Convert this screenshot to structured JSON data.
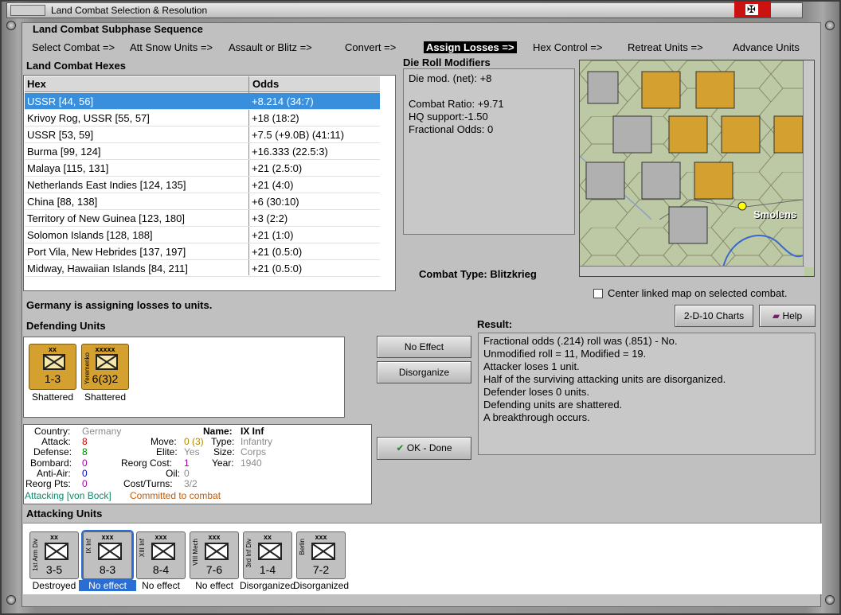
{
  "window": {
    "title": "Land Combat Selection & Resolution"
  },
  "sequence": {
    "title": "Land Combat Subphase Sequence",
    "steps": [
      "Select Combat =>",
      "Att Snow Units =>",
      "Assault or Blitz =>",
      "Convert =>",
      "Assign Losses =>",
      "Hex Control =>",
      "Retreat Units =>",
      "Advance Units"
    ],
    "active_index": 4
  },
  "hexes": {
    "title": "Land Combat Hexes",
    "col_hex": "Hex",
    "col_odds": "Odds",
    "rows": [
      {
        "hex": "USSR [44, 56]",
        "odds": "+8.214 (34:7)"
      },
      {
        "hex": "Krivoy Rog, USSR [55, 57]",
        "odds": "+18 (18:2)"
      },
      {
        "hex": "USSR [53, 59]",
        "odds": "+7.5 (+9.0B) (41:11)"
      },
      {
        "hex": "Burma [99, 124]",
        "odds": "+16.333 (22.5:3)"
      },
      {
        "hex": "Malaya [115, 131]",
        "odds": "+21 (2.5:0)"
      },
      {
        "hex": "Netherlands East Indies [124, 135]",
        "odds": "+21 (4:0)"
      },
      {
        "hex": "China [88, 138]",
        "odds": "+6 (30:10)"
      },
      {
        "hex": "Territory of New Guinea [123, 180]",
        "odds": "+3 (2:2)"
      },
      {
        "hex": "Solomon Islands [128, 188]",
        "odds": "+21 (1:0)"
      },
      {
        "hex": "Port Vila, New Hebrides [137, 197]",
        "odds": "+21 (0.5:0)"
      },
      {
        "hex": "Midway, Hawaiian Islands [84, 211]",
        "odds": "+21 (0.5:0)"
      }
    ]
  },
  "modifiers": {
    "title": "Die Roll Modifiers",
    "lines": [
      "Die mod. (net): +8",
      "",
      "Combat Ratio: +9.71",
      "HQ support:-1.50",
      "Fractional Odds: 0"
    ]
  },
  "map": {
    "city_label": "Smolens"
  },
  "combat_type": "Combat Type:  Blitzkrieg",
  "center_map_label": "Center linked map on selected combat.",
  "buttons": {
    "charts": "2-D-10 Charts",
    "help": "Help",
    "no_effect": "No Effect",
    "disorganize": "Disorganize",
    "ok_done": "OK - Done"
  },
  "status_message": "Germany is assigning losses to units.",
  "defending": {
    "title": "Defending Units",
    "units": [
      {
        "size": "xx",
        "strength": "1-3",
        "status": "Shattered",
        "side_label": ""
      },
      {
        "size": "xxxxx",
        "strength": "6(3)2",
        "status": "Shattered",
        "side_label": "Yeremenko"
      }
    ]
  },
  "unit_info": {
    "country_label": "Country:",
    "country": "Germany",
    "attack_label": "Attack:",
    "attack": "8",
    "defense_label": "Defense:",
    "defense": "8",
    "bombard_label": "Bombard:",
    "bombard": "0",
    "antiair_label": "Anti-Air:",
    "antiair": "0",
    "reorg_pts_label": "Reorg Pts:",
    "reorg_pts": "0",
    "move_label": "Move:",
    "move": "0 (3)",
    "elite_label": "Elite:",
    "elite": "Yes",
    "reorg_cost_label": "Reorg Cost:",
    "reorg_cost": "1",
    "oil_label": "Oil:",
    "oil": "0",
    "cost_turns_label": "Cost/Turns:",
    "cost_turns": "3/2",
    "name_label": "Name:",
    "name": "IX Inf",
    "type_label": "Type:",
    "type": "Infantry",
    "size_label": "Size:",
    "size": "Corps",
    "year_label": "Year:",
    "year": "1940",
    "attacking": "Attacking [von Bock]",
    "committed": "Committed to combat"
  },
  "result": {
    "title": "Result:",
    "lines": [
      "Fractional odds (.214) roll was (.851)  - No.",
      "Unmodified roll = 11, Modified = 19.",
      "Attacker loses 1 unit.",
      "Half of the surviving attacking units are disorganized.",
      "Defender loses 0 units.",
      "Defending units are shattered.",
      "A breakthrough occurs."
    ]
  },
  "attacking": {
    "title": "Attacking Units",
    "selected_index": 1,
    "units": [
      {
        "size": "xx",
        "strength": "3-5",
        "status": "Destroyed",
        "side_label": "1st Arm Div"
      },
      {
        "size": "xxx",
        "strength": "8-3",
        "status": "No effect",
        "side_label": "IX Inf"
      },
      {
        "size": "xxx",
        "strength": "8-4",
        "status": "No effect",
        "side_label": "XIII Inf"
      },
      {
        "size": "xxx",
        "strength": "7-6",
        "status": "No effect",
        "side_label": "VIII Mech"
      },
      {
        "size": "xx",
        "strength": "1-4",
        "status": "Disorganized",
        "side_label": "3rd Inf Div"
      },
      {
        "size": "xxx",
        "strength": "7-2",
        "status": "Disorganized",
        "side_label": "Berlin"
      }
    ]
  }
}
